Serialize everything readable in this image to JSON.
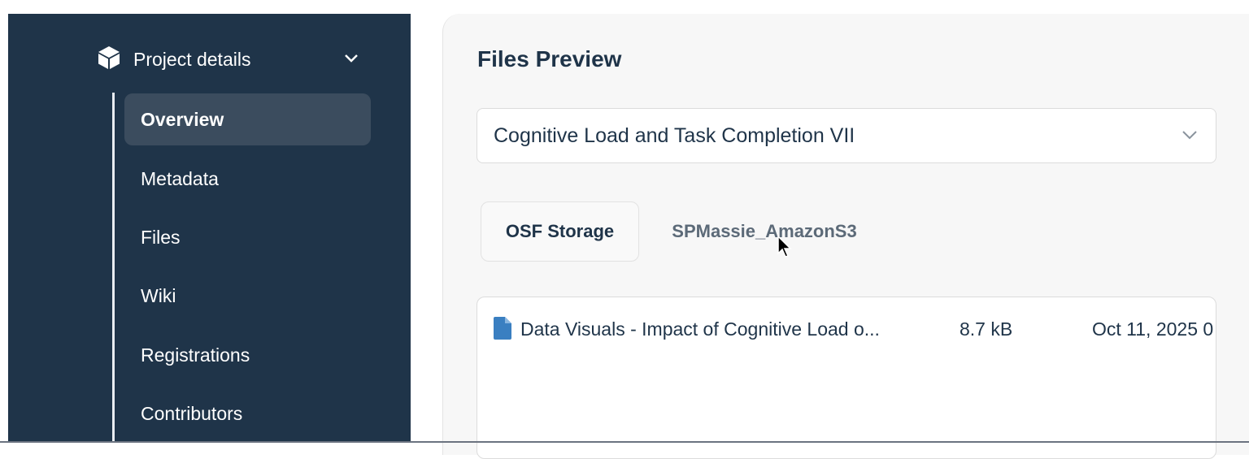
{
  "sidebar": {
    "section": {
      "label": "Project details",
      "icon": "cube-icon",
      "chevron": "chevron-down-icon"
    },
    "items": [
      {
        "label": "Overview",
        "active": true
      },
      {
        "label": "Metadata"
      },
      {
        "label": "Files"
      },
      {
        "label": "Wiki"
      },
      {
        "label": "Registrations"
      },
      {
        "label": "Contributors"
      }
    ],
    "bg_color": "#1f3449",
    "active_bg_color": "#3b4c5e"
  },
  "main": {
    "title": "Files Preview",
    "project_select": {
      "value": "Cognitive Load and Task Completion VII",
      "icon": "chevron-down-icon"
    },
    "tabs": [
      {
        "label": "OSF Storage",
        "active": true
      },
      {
        "label": "SPMassie_AmazonS3",
        "active": false
      }
    ],
    "files": [
      {
        "icon": "file-icon",
        "name": "Data Visuals - Impact of Cognitive Load o...",
        "size": "8.7 kB",
        "modified": "Oct 11, 2025 0"
      }
    ],
    "file_icon_color": "#3a7fc1",
    "text_color": "#1f3449"
  }
}
